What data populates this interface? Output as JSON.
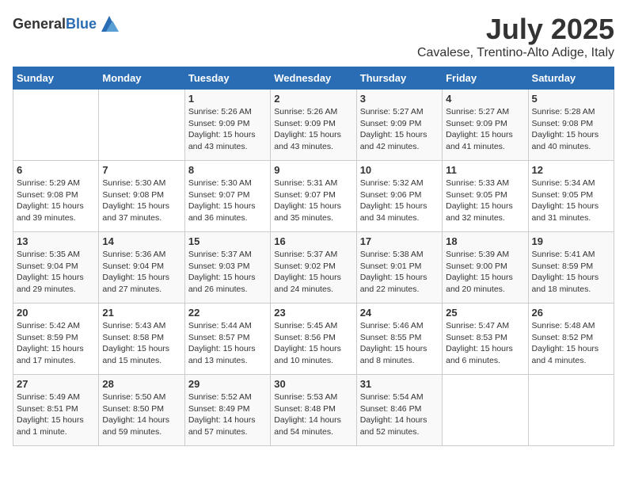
{
  "header": {
    "logo_general": "General",
    "logo_blue": "Blue",
    "month_title": "July 2025",
    "location": "Cavalese, Trentino-Alto Adige, Italy"
  },
  "days_of_week": [
    "Sunday",
    "Monday",
    "Tuesday",
    "Wednesday",
    "Thursday",
    "Friday",
    "Saturday"
  ],
  "weeks": [
    [
      {
        "day": "",
        "sunrise": "",
        "sunset": "",
        "daylight": ""
      },
      {
        "day": "",
        "sunrise": "",
        "sunset": "",
        "daylight": ""
      },
      {
        "day": "1",
        "sunrise": "Sunrise: 5:26 AM",
        "sunset": "Sunset: 9:09 PM",
        "daylight": "Daylight: 15 hours and 43 minutes."
      },
      {
        "day": "2",
        "sunrise": "Sunrise: 5:26 AM",
        "sunset": "Sunset: 9:09 PM",
        "daylight": "Daylight: 15 hours and 43 minutes."
      },
      {
        "day": "3",
        "sunrise": "Sunrise: 5:27 AM",
        "sunset": "Sunset: 9:09 PM",
        "daylight": "Daylight: 15 hours and 42 minutes."
      },
      {
        "day": "4",
        "sunrise": "Sunrise: 5:27 AM",
        "sunset": "Sunset: 9:09 PM",
        "daylight": "Daylight: 15 hours and 41 minutes."
      },
      {
        "day": "5",
        "sunrise": "Sunrise: 5:28 AM",
        "sunset": "Sunset: 9:08 PM",
        "daylight": "Daylight: 15 hours and 40 minutes."
      }
    ],
    [
      {
        "day": "6",
        "sunrise": "Sunrise: 5:29 AM",
        "sunset": "Sunset: 9:08 PM",
        "daylight": "Daylight: 15 hours and 39 minutes."
      },
      {
        "day": "7",
        "sunrise": "Sunrise: 5:30 AM",
        "sunset": "Sunset: 9:08 PM",
        "daylight": "Daylight: 15 hours and 37 minutes."
      },
      {
        "day": "8",
        "sunrise": "Sunrise: 5:30 AM",
        "sunset": "Sunset: 9:07 PM",
        "daylight": "Daylight: 15 hours and 36 minutes."
      },
      {
        "day": "9",
        "sunrise": "Sunrise: 5:31 AM",
        "sunset": "Sunset: 9:07 PM",
        "daylight": "Daylight: 15 hours and 35 minutes."
      },
      {
        "day": "10",
        "sunrise": "Sunrise: 5:32 AM",
        "sunset": "Sunset: 9:06 PM",
        "daylight": "Daylight: 15 hours and 34 minutes."
      },
      {
        "day": "11",
        "sunrise": "Sunrise: 5:33 AM",
        "sunset": "Sunset: 9:05 PM",
        "daylight": "Daylight: 15 hours and 32 minutes."
      },
      {
        "day": "12",
        "sunrise": "Sunrise: 5:34 AM",
        "sunset": "Sunset: 9:05 PM",
        "daylight": "Daylight: 15 hours and 31 minutes."
      }
    ],
    [
      {
        "day": "13",
        "sunrise": "Sunrise: 5:35 AM",
        "sunset": "Sunset: 9:04 PM",
        "daylight": "Daylight: 15 hours and 29 minutes."
      },
      {
        "day": "14",
        "sunrise": "Sunrise: 5:36 AM",
        "sunset": "Sunset: 9:04 PM",
        "daylight": "Daylight: 15 hours and 27 minutes."
      },
      {
        "day": "15",
        "sunrise": "Sunrise: 5:37 AM",
        "sunset": "Sunset: 9:03 PM",
        "daylight": "Daylight: 15 hours and 26 minutes."
      },
      {
        "day": "16",
        "sunrise": "Sunrise: 5:37 AM",
        "sunset": "Sunset: 9:02 PM",
        "daylight": "Daylight: 15 hours and 24 minutes."
      },
      {
        "day": "17",
        "sunrise": "Sunrise: 5:38 AM",
        "sunset": "Sunset: 9:01 PM",
        "daylight": "Daylight: 15 hours and 22 minutes."
      },
      {
        "day": "18",
        "sunrise": "Sunrise: 5:39 AM",
        "sunset": "Sunset: 9:00 PM",
        "daylight": "Daylight: 15 hours and 20 minutes."
      },
      {
        "day": "19",
        "sunrise": "Sunrise: 5:41 AM",
        "sunset": "Sunset: 8:59 PM",
        "daylight": "Daylight: 15 hours and 18 minutes."
      }
    ],
    [
      {
        "day": "20",
        "sunrise": "Sunrise: 5:42 AM",
        "sunset": "Sunset: 8:59 PM",
        "daylight": "Daylight: 15 hours and 17 minutes."
      },
      {
        "day": "21",
        "sunrise": "Sunrise: 5:43 AM",
        "sunset": "Sunset: 8:58 PM",
        "daylight": "Daylight: 15 hours and 15 minutes."
      },
      {
        "day": "22",
        "sunrise": "Sunrise: 5:44 AM",
        "sunset": "Sunset: 8:57 PM",
        "daylight": "Daylight: 15 hours and 13 minutes."
      },
      {
        "day": "23",
        "sunrise": "Sunrise: 5:45 AM",
        "sunset": "Sunset: 8:56 PM",
        "daylight": "Daylight: 15 hours and 10 minutes."
      },
      {
        "day": "24",
        "sunrise": "Sunrise: 5:46 AM",
        "sunset": "Sunset: 8:55 PM",
        "daylight": "Daylight: 15 hours and 8 minutes."
      },
      {
        "day": "25",
        "sunrise": "Sunrise: 5:47 AM",
        "sunset": "Sunset: 8:53 PM",
        "daylight": "Daylight: 15 hours and 6 minutes."
      },
      {
        "day": "26",
        "sunrise": "Sunrise: 5:48 AM",
        "sunset": "Sunset: 8:52 PM",
        "daylight": "Daylight: 15 hours and 4 minutes."
      }
    ],
    [
      {
        "day": "27",
        "sunrise": "Sunrise: 5:49 AM",
        "sunset": "Sunset: 8:51 PM",
        "daylight": "Daylight: 15 hours and 1 minute."
      },
      {
        "day": "28",
        "sunrise": "Sunrise: 5:50 AM",
        "sunset": "Sunset: 8:50 PM",
        "daylight": "Daylight: 14 hours and 59 minutes."
      },
      {
        "day": "29",
        "sunrise": "Sunrise: 5:52 AM",
        "sunset": "Sunset: 8:49 PM",
        "daylight": "Daylight: 14 hours and 57 minutes."
      },
      {
        "day": "30",
        "sunrise": "Sunrise: 5:53 AM",
        "sunset": "Sunset: 8:48 PM",
        "daylight": "Daylight: 14 hours and 54 minutes."
      },
      {
        "day": "31",
        "sunrise": "Sunrise: 5:54 AM",
        "sunset": "Sunset: 8:46 PM",
        "daylight": "Daylight: 14 hours and 52 minutes."
      },
      {
        "day": "",
        "sunrise": "",
        "sunset": "",
        "daylight": ""
      },
      {
        "day": "",
        "sunrise": "",
        "sunset": "",
        "daylight": ""
      }
    ]
  ]
}
